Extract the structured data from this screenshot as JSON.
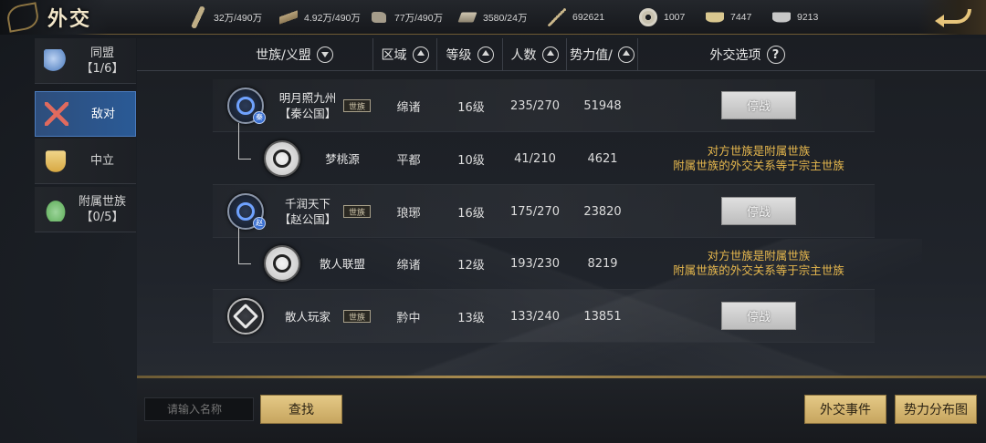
{
  "header": {
    "title": "外交",
    "resources": [
      {
        "icon": "grain-icon",
        "value": "32万/490万"
      },
      {
        "icon": "wood-icon",
        "value": "4.92万/490万"
      },
      {
        "icon": "stone-icon",
        "value": "77万/490万"
      },
      {
        "icon": "iron-icon",
        "value": "3580/24万"
      },
      {
        "icon": "order-icon",
        "value": "692621"
      },
      {
        "icon": "coin-icon",
        "value": "1007"
      },
      {
        "icon": "gold-ingot-icon",
        "value": "7447"
      },
      {
        "icon": "silver-ingot-icon",
        "value": "9213"
      }
    ]
  },
  "sidebar": {
    "items": [
      {
        "label": "同盟",
        "sub": "【1/6】",
        "icon": "alliance-icon",
        "active": false
      },
      {
        "label": "敌对",
        "sub": "",
        "icon": "crossed-swords-icon",
        "active": true
      },
      {
        "label": "中立",
        "sub": "",
        "icon": "banner-icon",
        "active": false
      },
      {
        "label": "附属世族",
        "sub": "【0/5】",
        "icon": "vassal-icon",
        "active": false
      }
    ]
  },
  "table": {
    "columns": {
      "clan": "世族/义盟",
      "region": "区域",
      "level": "等级",
      "members": "人数",
      "power": "势力值/",
      "diplomacy": "外交选项"
    },
    "badge_label": "世族",
    "rows": [
      {
        "name": "明月照九州",
        "sub": "【秦公国】",
        "badge": true,
        "emblem_tag": "秦",
        "region": "绵诸",
        "level": "16级",
        "members": "235/270",
        "power": "51948",
        "action": "停战",
        "note1": "",
        "note2": ""
      },
      {
        "name": "梦桃源",
        "sub": "",
        "badge": false,
        "emblem_tag": "",
        "region": "平都",
        "level": "10级",
        "members": "41/210",
        "power": "4621",
        "action": "",
        "note1": "对方世族是附属世族",
        "note2": "附属世族的外交关系等于宗主世族"
      },
      {
        "name": "千润天下",
        "sub": "【赵公国】",
        "badge": true,
        "emblem_tag": "赵",
        "region": "琅琊",
        "level": "16级",
        "members": "175/270",
        "power": "23820",
        "action": "停战",
        "note1": "",
        "note2": ""
      },
      {
        "name": "散人联盟",
        "sub": "",
        "badge": false,
        "emblem_tag": "",
        "region": "绵诸",
        "level": "12级",
        "members": "193/230",
        "power": "8219",
        "action": "",
        "note1": "对方世族是附属世族",
        "note2": "附属世族的外交关系等于宗主世族"
      },
      {
        "name": "散人玩家",
        "sub": "",
        "badge": true,
        "emblem_tag": "",
        "region": "黔中",
        "level": "13级",
        "members": "133/240",
        "power": "13851",
        "action": "停战",
        "note1": "",
        "note2": ""
      }
    ]
  },
  "bottom": {
    "search_placeholder": "请输入名称",
    "search_button": "查找",
    "events_button": "外交事件",
    "distribution_button": "势力分布图"
  }
}
